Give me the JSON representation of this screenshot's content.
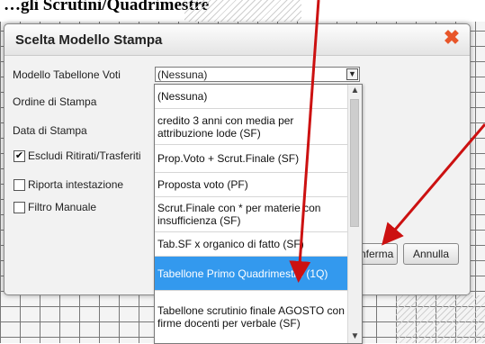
{
  "background": {
    "heading": "…gli Scrutini/Quadrimestre"
  },
  "dialog": {
    "title": "Scelta Modello Stampa",
    "close_icon": "close-icon",
    "fields": {
      "modello_label": "Modello Tabellone Voti",
      "modello_value": "(Nessuna)",
      "ordine_label": "Ordine di Stampa",
      "data_label": "Data di Stampa"
    },
    "checkboxes": [
      {
        "label": "Escludi Ritirati/Trasferiti",
        "checked": true
      },
      {
        "label": "Riporta intestazione",
        "checked": false
      },
      {
        "label": "Filtro Manuale",
        "checked": false
      }
    ],
    "buttons": {
      "confirm": "Conferma",
      "cancel": "Annulla"
    }
  },
  "dropdown": {
    "items": [
      {
        "label": "(Nessuna)",
        "selected": false
      },
      {
        "label": "credito 3 anni con media per attribuzione lode (SF)",
        "selected": false
      },
      {
        "label": "Prop.Voto + Scrut.Finale (SF)",
        "selected": false
      },
      {
        "label": "Proposta voto (PF)",
        "selected": false
      },
      {
        "label": "Scrut.Finale con * per materie con insufficienza (SF)",
        "selected": false
      },
      {
        "label": "Tab.SF x organico di fatto (SF)",
        "selected": false
      },
      {
        "label": "Tabellone Primo Quadrimestre (1Q)",
        "selected": true
      },
      {
        "label": "Tabellone scrutinio finale AGOSTO con firme docenti per verbale (SF)",
        "selected": false
      }
    ]
  },
  "colors": {
    "selection": "#3399ee",
    "close": "#e8562a",
    "arrow": "#cc1111"
  }
}
